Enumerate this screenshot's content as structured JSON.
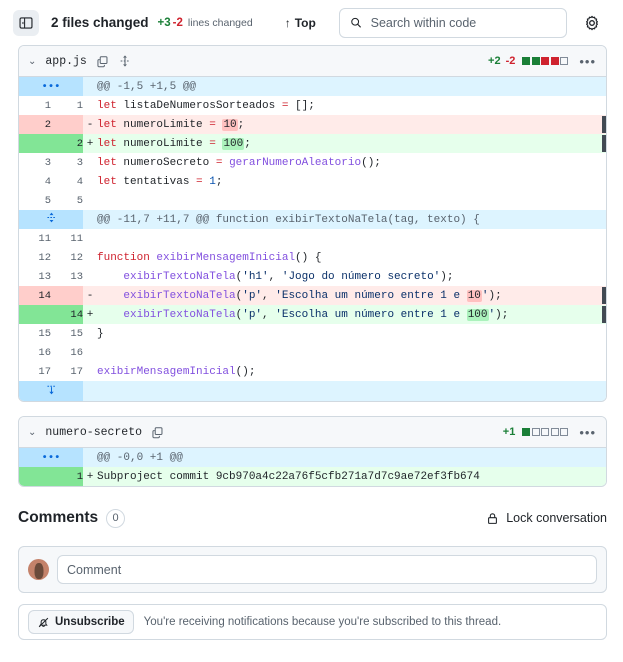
{
  "toolbar": {
    "sidebar_toggle_icon": "sidebar-toggle-icon",
    "files_changed": "2 files changed",
    "additions": "+3",
    "deletions": "-2",
    "lines_changed_label": "lines changed",
    "top_arrow": "↑",
    "top_label": "Top",
    "search_placeholder": "Search within code",
    "search_value": "",
    "search_icon": "search-icon",
    "gear_icon": "gear-icon"
  },
  "files": [
    {
      "name": "app.js",
      "chevron": "⌄",
      "copy_icon": "copy-icon",
      "expand_icon": "expand-all-icon",
      "additions": "+2",
      "deletions": "-2",
      "squares": [
        "green",
        "green",
        "red",
        "red",
        "empty"
      ],
      "kebab": "•••",
      "hunks": [
        {
          "gutter": "•••",
          "header": "@@ -1,5 +1,5 @@",
          "rows": [
            {
              "type": "ctx",
              "old": "1",
              "new": "1",
              "sign": "",
              "tokens": [
                [
                  "k",
                  "let"
                ],
                [
                  "p",
                  " listaDeNumerosSorteados "
                ],
                [
                  "k",
                  "="
                ],
                [
                  "p",
                  " [];"
                ]
              ]
            },
            {
              "type": "del",
              "old": "2",
              "new": "",
              "sign": "-",
              "marker": true,
              "tokens": [
                [
                  "k",
                  "let"
                ],
                [
                  "p",
                  " numeroLimite "
                ],
                [
                  "k",
                  "="
                ],
                [
                  "p",
                  " "
                ],
                [
                  "hl-del",
                  "10"
                ],
                [
                  "p",
                  ";"
                ]
              ]
            },
            {
              "type": "add",
              "old": "",
              "new": "2",
              "sign": "+",
              "marker": true,
              "tokens": [
                [
                  "k",
                  "let"
                ],
                [
                  "p",
                  " numeroLimite "
                ],
                [
                  "k",
                  "="
                ],
                [
                  "p",
                  " "
                ],
                [
                  "hl-add",
                  "100"
                ],
                [
                  "p",
                  ";"
                ]
              ]
            },
            {
              "type": "ctx",
              "old": "3",
              "new": "3",
              "sign": "",
              "tokens": [
                [
                  "k",
                  "let"
                ],
                [
                  "p",
                  " numeroSecreto "
                ],
                [
                  "k",
                  "="
                ],
                [
                  "p",
                  " "
                ],
                [
                  "fn",
                  "gerarNumeroAleatorio"
                ],
                [
                  "p",
                  "();"
                ]
              ]
            },
            {
              "type": "ctx",
              "old": "4",
              "new": "4",
              "sign": "",
              "tokens": [
                [
                  "k",
                  "let"
                ],
                [
                  "p",
                  " tentativas "
                ],
                [
                  "k",
                  "="
                ],
                [
                  "p",
                  " "
                ],
                [
                  "n",
                  "1"
                ],
                [
                  "p",
                  ";"
                ]
              ]
            },
            {
              "type": "ctx",
              "old": "5",
              "new": "5",
              "sign": "",
              "tokens": []
            }
          ]
        },
        {
          "gutter": "expand",
          "header": "@@ -11,7 +11,7 @@ function exibirTextoNaTela(tag, texto) {",
          "rows": [
            {
              "type": "ctx",
              "old": "11",
              "new": "11",
              "sign": "",
              "tokens": []
            },
            {
              "type": "ctx",
              "old": "12",
              "new": "12",
              "sign": "",
              "tokens": [
                [
                  "k",
                  "function"
                ],
                [
                  "p",
                  " "
                ],
                [
                  "fn",
                  "exibirMensagemInicial"
                ],
                [
                  "p",
                  "() {"
                ]
              ]
            },
            {
              "type": "ctx",
              "old": "13",
              "new": "13",
              "sign": "",
              "tokens": [
                [
                  "p",
                  "    "
                ],
                [
                  "fn",
                  "exibirTextoNaTela"
                ],
                [
                  "p",
                  "("
                ],
                [
                  "s",
                  "'h1'"
                ],
                [
                  "p",
                  ", "
                ],
                [
                  "s",
                  "'Jogo do número secreto'"
                ],
                [
                  "p",
                  ");"
                ]
              ]
            },
            {
              "type": "del",
              "old": "14",
              "new": "",
              "sign": "-",
              "marker": true,
              "tokens": [
                [
                  "p",
                  "    "
                ],
                [
                  "fn",
                  "exibirTextoNaTela"
                ],
                [
                  "p",
                  "("
                ],
                [
                  "s",
                  "'p'"
                ],
                [
                  "p",
                  ", "
                ],
                [
                  "s",
                  "'Escolha um número entre 1 e "
                ],
                [
                  "hl-del",
                  "10"
                ],
                [
                  "s",
                  "'"
                ],
                [
                  "p",
                  ");"
                ]
              ]
            },
            {
              "type": "add",
              "old": "",
              "new": "14",
              "sign": "+",
              "marker": true,
              "tokens": [
                [
                  "p",
                  "    "
                ],
                [
                  "fn",
                  "exibirTextoNaTela"
                ],
                [
                  "p",
                  "("
                ],
                [
                  "s",
                  "'p'"
                ],
                [
                  "p",
                  ", "
                ],
                [
                  "s",
                  "'Escolha um número entre 1 e "
                ],
                [
                  "hl-add",
                  "100"
                ],
                [
                  "s",
                  "'"
                ],
                [
                  "p",
                  ");"
                ]
              ]
            },
            {
              "type": "ctx",
              "old": "15",
              "new": "15",
              "sign": "",
              "tokens": [
                [
                  "p",
                  "}"
                ]
              ]
            },
            {
              "type": "ctx",
              "old": "16",
              "new": "16",
              "sign": "",
              "tokens": []
            },
            {
              "type": "ctx",
              "old": "17",
              "new": "17",
              "sign": "",
              "tokens": [
                [
                  "fn",
                  "exibirMensagemInicial"
                ],
                [
                  "p",
                  "();"
                ]
              ]
            }
          ]
        }
      ],
      "footer_expander": "↓"
    },
    {
      "name": "numero-secreto",
      "chevron": "⌄",
      "copy_icon": "copy-icon",
      "additions": "+1",
      "deletions": "",
      "squares": [
        "green",
        "empty",
        "empty",
        "empty",
        "empty"
      ],
      "kebab": "•••",
      "hunks": [
        {
          "gutter": "•••",
          "header": "@@ -0,0 +1 @@",
          "rows": [
            {
              "type": "add",
              "old": "",
              "new": "1",
              "sign": "+",
              "tokens": [
                [
                  "p",
                  "Subproject commit 9cb970a4c22a76f5cfb271a7d7c9ae72ef3fb674"
                ]
              ]
            }
          ]
        }
      ]
    }
  ],
  "comments": {
    "title": "Comments",
    "count": "0",
    "lock_icon": "lock-icon",
    "lock_label": "Lock conversation",
    "avatar": "user-avatar",
    "comment_placeholder": "Comment",
    "comment_value": ""
  },
  "notifications": {
    "bell_icon": "bell-slash-icon",
    "unsubscribe_label": "Unsubscribe",
    "text": "You're receiving notifications because you're subscribed to this thread."
  }
}
